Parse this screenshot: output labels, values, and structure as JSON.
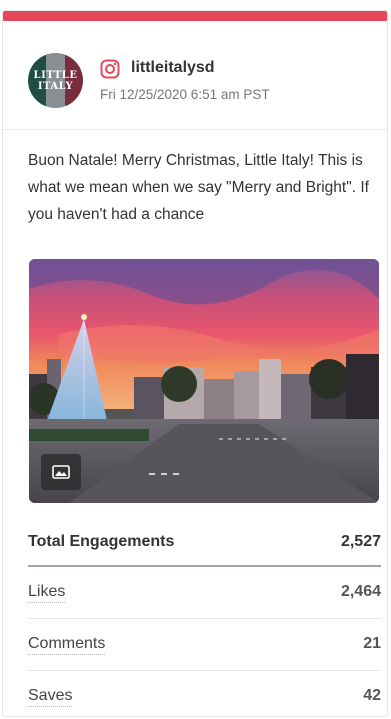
{
  "post": {
    "network_icon": "instagram-icon",
    "handle": "littleitalysd",
    "timestamp": "Fri 12/25/2020 6:51 am PST",
    "avatar_line1": "LITTLE",
    "avatar_line2": "ITALY",
    "caption": "Buon Natale! Merry Christmas, Little Italy! This is what we mean when we say \"Merry and Bright\". If you haven't had a chance",
    "media_badge_icon": "image-icon",
    "accent_color": "#e5475a"
  },
  "stats": {
    "total_label": "Total Engagements",
    "total_value": "2,527",
    "rows": [
      {
        "label": "Likes",
        "value": "2,464"
      },
      {
        "label": "Comments",
        "value": "21"
      },
      {
        "label": "Saves",
        "value": "42"
      }
    ]
  }
}
